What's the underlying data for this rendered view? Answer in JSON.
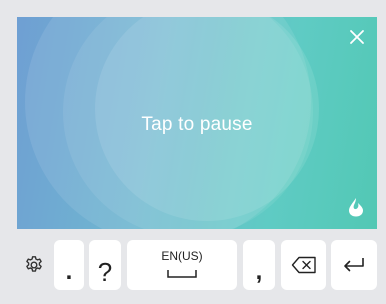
{
  "voice_panel": {
    "status_text": "Tap to pause",
    "close_icon": "close-icon",
    "brand_icon": "voice-brand-icon"
  },
  "keyboard": {
    "settings_icon": "gear-icon",
    "period_label": ".",
    "question_label": "?",
    "space_language": "EN(US)",
    "space_icon": "space-bar-icon",
    "comma_label": ",",
    "backspace_icon": "backspace-icon",
    "enter_icon": "enter-icon"
  },
  "colors": {
    "gradient_left": "#6f9fd3",
    "gradient_right": "#52c8b4",
    "keyboard_bg": "#e6e7ea",
    "key_bg": "#ffffff"
  }
}
